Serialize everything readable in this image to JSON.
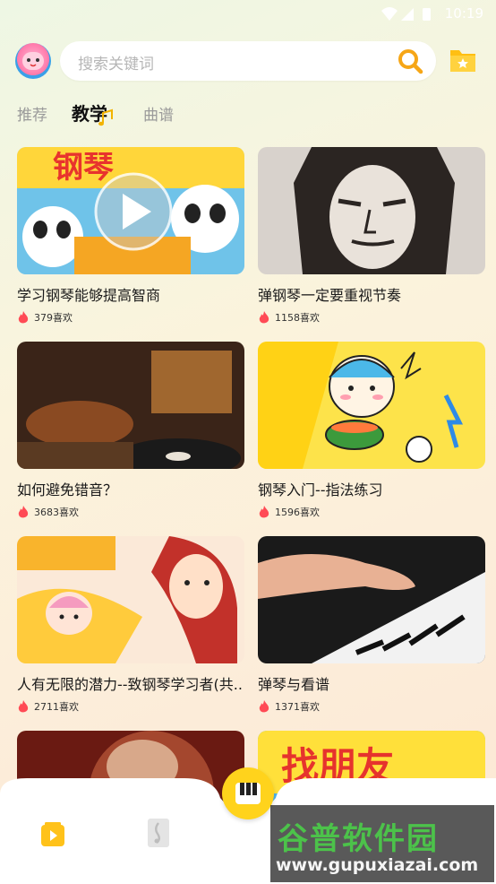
{
  "status_bar": {
    "time": "10:19"
  },
  "header": {
    "search": {
      "placeholder": "搜索关键词"
    },
    "avatar_icon": "baby-panda-avatar",
    "folder_icon": "star-folder-icon"
  },
  "tabs": [
    {
      "label": "推荐",
      "active": false
    },
    {
      "label": "教学",
      "active": true
    },
    {
      "label": "曲谱",
      "active": false
    }
  ],
  "cards": [
    {
      "title": "学习钢琴能够提高智商",
      "likes": "379喜欢",
      "thumb": "pandas-video"
    },
    {
      "title": "弹钢琴一定要重视节奏",
      "likes": "1158喜欢",
      "thumb": "beethoven-portrait"
    },
    {
      "title": "如何避免错音？",
      "likes": "3683喜欢",
      "thumb": "record-player"
    },
    {
      "title": "钢琴入门--指法练习",
      "likes": "1596喜欢",
      "thumb": "cartoon-girl"
    },
    {
      "title": "人有无限的潜力--致钢琴学习者(共..",
      "likes": "2711喜欢",
      "thumb": "cartoon-mother"
    },
    {
      "title": "弹琴与看谱",
      "likes": "1371喜欢",
      "thumb": "hands-on-keys"
    },
    {
      "title": "",
      "likes": "",
      "thumb": "portrait-partial"
    },
    {
      "title": "",
      "likes": "",
      "thumb": "find-friends-banner"
    }
  ],
  "thumb_text": {
    "card1": "钢琴",
    "card8": "找朋友"
  },
  "bottom_nav": {
    "items": [
      "video-icon",
      "score-icon"
    ],
    "center": "piano-keys-icon"
  },
  "watermark": {
    "main": "谷普软件园",
    "url": "www.gupuxiazai.com"
  },
  "colors": {
    "accent": "#ffd31c",
    "fire": "#ff4a55",
    "active_tab": "#111111",
    "inactive_tab": "#9a9a9a"
  }
}
